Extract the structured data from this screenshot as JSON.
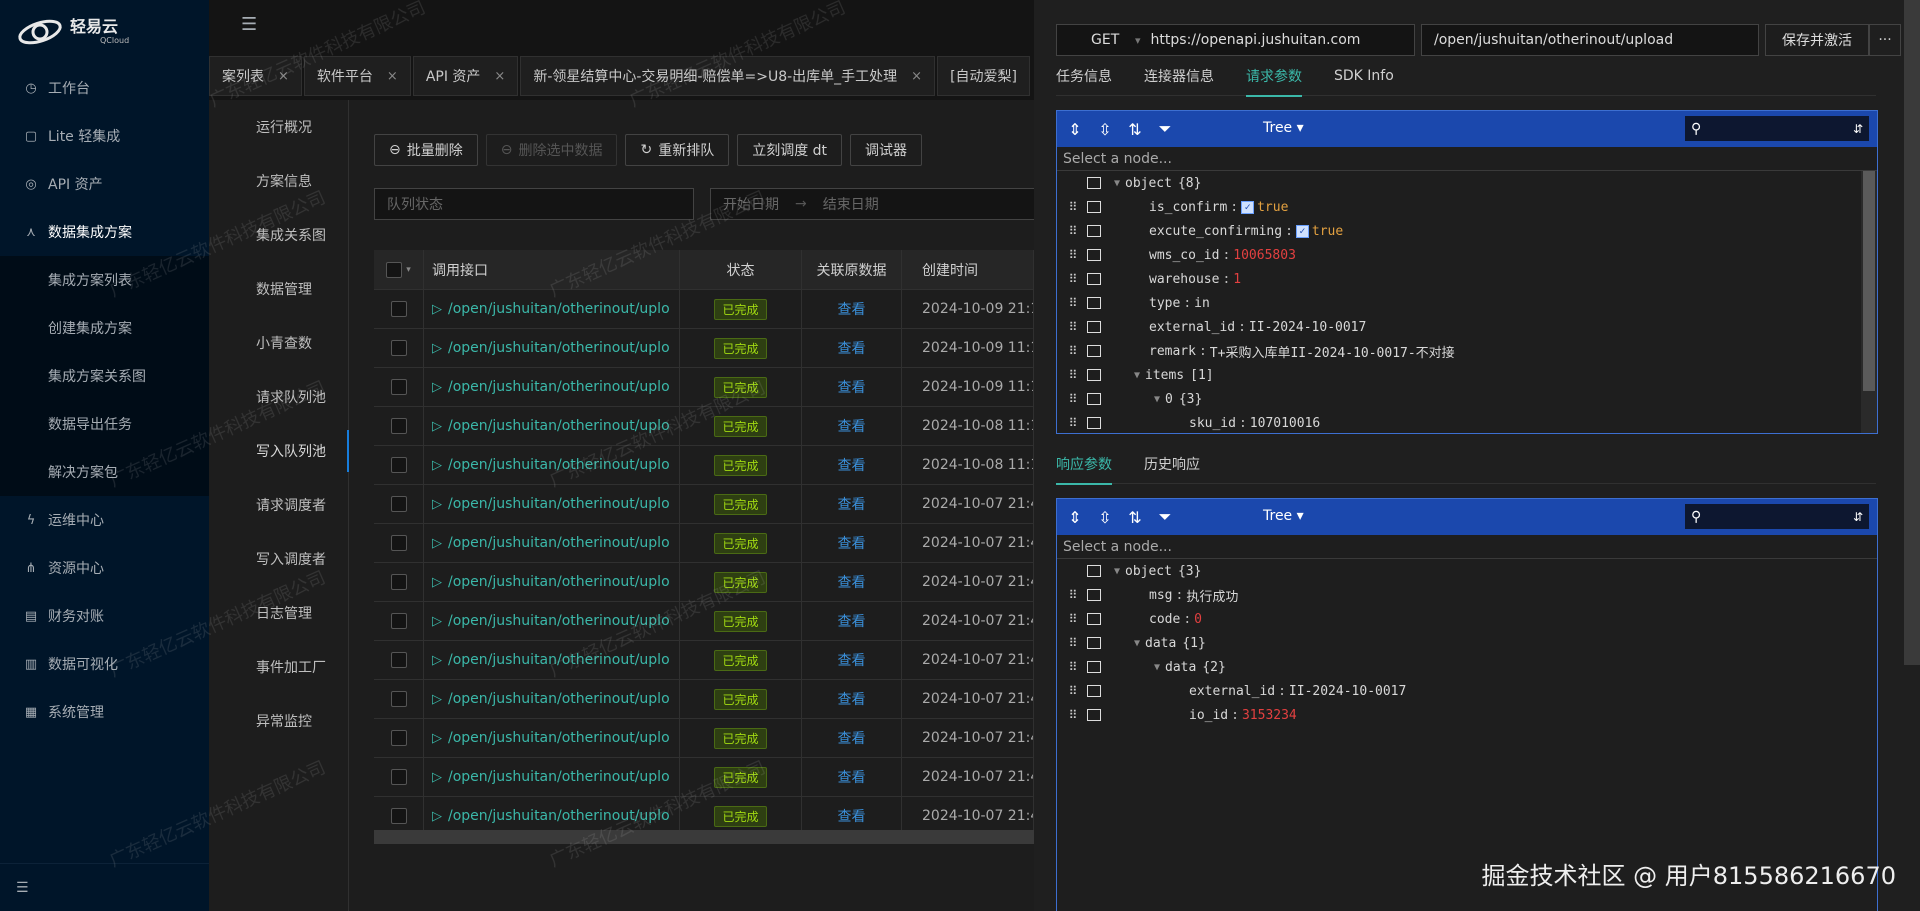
{
  "sidebar": {
    "brand": "轻易云",
    "brand_sub": "QCloud",
    "items": [
      {
        "label": "工作台",
        "icon": "clock-icon"
      },
      {
        "label": "Lite 轻集成",
        "icon": "lite-icon"
      },
      {
        "label": "API 资产",
        "icon": "compass-icon"
      },
      {
        "label": "数据集成方案",
        "icon": "cluster-icon",
        "open": true,
        "children": [
          "集成方案列表",
          "创建集成方案",
          "集成方案关系图",
          "数据导出任务",
          "解决方案包"
        ]
      },
      {
        "label": "运维中心",
        "icon": "bolt-icon"
      },
      {
        "label": "资源中心",
        "icon": "sitemap-icon"
      },
      {
        "label": "财务对账",
        "icon": "ledger-icon"
      },
      {
        "label": "数据可视化",
        "icon": "chart-icon"
      },
      {
        "label": "系统管理",
        "icon": "appstore-icon"
      }
    ]
  },
  "tabs": [
    {
      "label": "案列表"
    },
    {
      "label": "软件平台"
    },
    {
      "label": "API 资产"
    },
    {
      "label": "新-领星结算中心-交易明细-赔偿单=>U8-出库单_手工处理"
    },
    {
      "label": "[自动爱梨]"
    }
  ],
  "subnav": [
    "运行概况",
    "方案信息",
    "集成关系图",
    "数据管理",
    "小青查数",
    "请求队列池",
    "写入队列池",
    "请求调度者",
    "写入调度者",
    "日志管理",
    "事件加工厂",
    "异常监控"
  ],
  "subnav_active": "写入队列池",
  "toolbar": {
    "batch_delete": "批量删除",
    "delete_selected": "删除选中数据",
    "requeue": "重新排队",
    "dispatch": "立刻调度 dt",
    "debugger": "调试器"
  },
  "filters": {
    "queue_status_placeholder": "队列状态",
    "start_date_placeholder": "开始日期",
    "end_date_placeholder": "结束日期"
  },
  "table": {
    "headers": {
      "api": "调用接口",
      "status": "状态",
      "related": "关联原数据",
      "created": "创建时间"
    },
    "rows": [
      {
        "api": "/open/jushuitan/otherinout/uplo",
        "status": "已完成",
        "related": "查看",
        "created": "2024-10-09 21:15:"
      },
      {
        "api": "/open/jushuitan/otherinout/uplo",
        "status": "已完成",
        "related": "查看",
        "created": "2024-10-09 11:15:"
      },
      {
        "api": "/open/jushuitan/otherinout/uplo",
        "status": "已完成",
        "related": "查看",
        "created": "2024-10-09 11:15:"
      },
      {
        "api": "/open/jushuitan/otherinout/uplo",
        "status": "已完成",
        "related": "查看",
        "created": "2024-10-08 11:15:"
      },
      {
        "api": "/open/jushuitan/otherinout/uplo",
        "status": "已完成",
        "related": "查看",
        "created": "2024-10-08 11:15:"
      },
      {
        "api": "/open/jushuitan/otherinout/uplo",
        "status": "已完成",
        "related": "查看",
        "created": "2024-10-07 21:45:"
      },
      {
        "api": "/open/jushuitan/otherinout/uplo",
        "status": "已完成",
        "related": "查看",
        "created": "2024-10-07 21:45:"
      },
      {
        "api": "/open/jushuitan/otherinout/uplo",
        "status": "已完成",
        "related": "查看",
        "created": "2024-10-07 21:45:"
      },
      {
        "api": "/open/jushuitan/otherinout/uplo",
        "status": "已完成",
        "related": "查看",
        "created": "2024-10-07 21:45:"
      },
      {
        "api": "/open/jushuitan/otherinout/uplo",
        "status": "已完成",
        "related": "查看",
        "created": "2024-10-07 21:45:"
      },
      {
        "api": "/open/jushuitan/otherinout/uplo",
        "status": "已完成",
        "related": "查看",
        "created": "2024-10-07 21:45:"
      },
      {
        "api": "/open/jushuitan/otherinout/uplo",
        "status": "已完成",
        "related": "查看",
        "created": "2024-10-07 21:45:"
      },
      {
        "api": "/open/jushuitan/otherinout/uplo",
        "status": "已完成",
        "related": "查看",
        "created": "2024-10-07 21:45:"
      },
      {
        "api": "/open/jushuitan/otherinout/uplo",
        "status": "已完成",
        "related": "查看",
        "created": "2024-10-07 21:45:"
      }
    ]
  },
  "drawer": {
    "method": "GET",
    "base_url": "https://openapi.jushuitan.com",
    "path": "/open/jushuitan/otherinout/upload",
    "save_label": "保存并激活",
    "more_label": "···",
    "top_tabs": [
      "任务信息",
      "连接器信息",
      "请求参数",
      "SDK Info"
    ],
    "top_active": "请求参数",
    "bottom_tabs": [
      "响应参数",
      "历史响应"
    ],
    "bottom_active": "响应参数",
    "mode": "Tree",
    "nav_placeholder": "Select a node...",
    "request_tree": [
      {
        "depth": 0,
        "exp": "▼",
        "key": "object",
        "meta": "{8}"
      },
      {
        "depth": 1,
        "key": "is_confirm",
        "cb": true,
        "val": "true",
        "type": "bool"
      },
      {
        "depth": 1,
        "key": "excute_confirming",
        "cb": true,
        "val": "true",
        "type": "bool"
      },
      {
        "depth": 1,
        "key": "wms_co_id",
        "val": "10065803",
        "type": "num"
      },
      {
        "depth": 1,
        "key": "warehouse",
        "val": "1",
        "type": "num"
      },
      {
        "depth": 1,
        "key": "type",
        "val": "in",
        "type": "str"
      },
      {
        "depth": 1,
        "key": "external_id",
        "val": "II-2024-10-0017",
        "type": "str"
      },
      {
        "depth": 1,
        "key": "remark",
        "val": "T+采购入库单II-2024-10-0017-不对接",
        "type": "str"
      },
      {
        "depth": 1,
        "exp": "▼",
        "key": "items",
        "meta": "[1]"
      },
      {
        "depth": 2,
        "exp": "▼",
        "key": "0",
        "meta": "{3}"
      },
      {
        "depth": 3,
        "key": "sku_id",
        "val": "107010016",
        "type": "str"
      }
    ],
    "response_tree": [
      {
        "depth": 0,
        "exp": "▼",
        "key": "object",
        "meta": "{3}"
      },
      {
        "depth": 1,
        "key": "msg",
        "val": "执行成功",
        "type": "str"
      },
      {
        "depth": 1,
        "key": "code",
        "val": "0",
        "type": "num"
      },
      {
        "depth": 1,
        "exp": "▼",
        "key": "data",
        "meta": "{1}"
      },
      {
        "depth": 2,
        "exp": "▼",
        "key": "data",
        "meta": "{2}"
      },
      {
        "depth": 3,
        "key": "external_id",
        "val": "II-2024-10-0017",
        "type": "str"
      },
      {
        "depth": 3,
        "key": "io_id",
        "val": "3153234",
        "type": "num"
      }
    ]
  },
  "watermark_text": "广东轻亿云软件科技有限公司",
  "footer_watermark": "掘金技术社区 @ 用户815586216670",
  "colors": {
    "accent": "#3bb8a9",
    "editor_toolbar": "#1b48ad",
    "success_tag": "#a0d911",
    "link": "#3a8fd9",
    "number": "#e24040",
    "boolean": "#e2a040"
  }
}
